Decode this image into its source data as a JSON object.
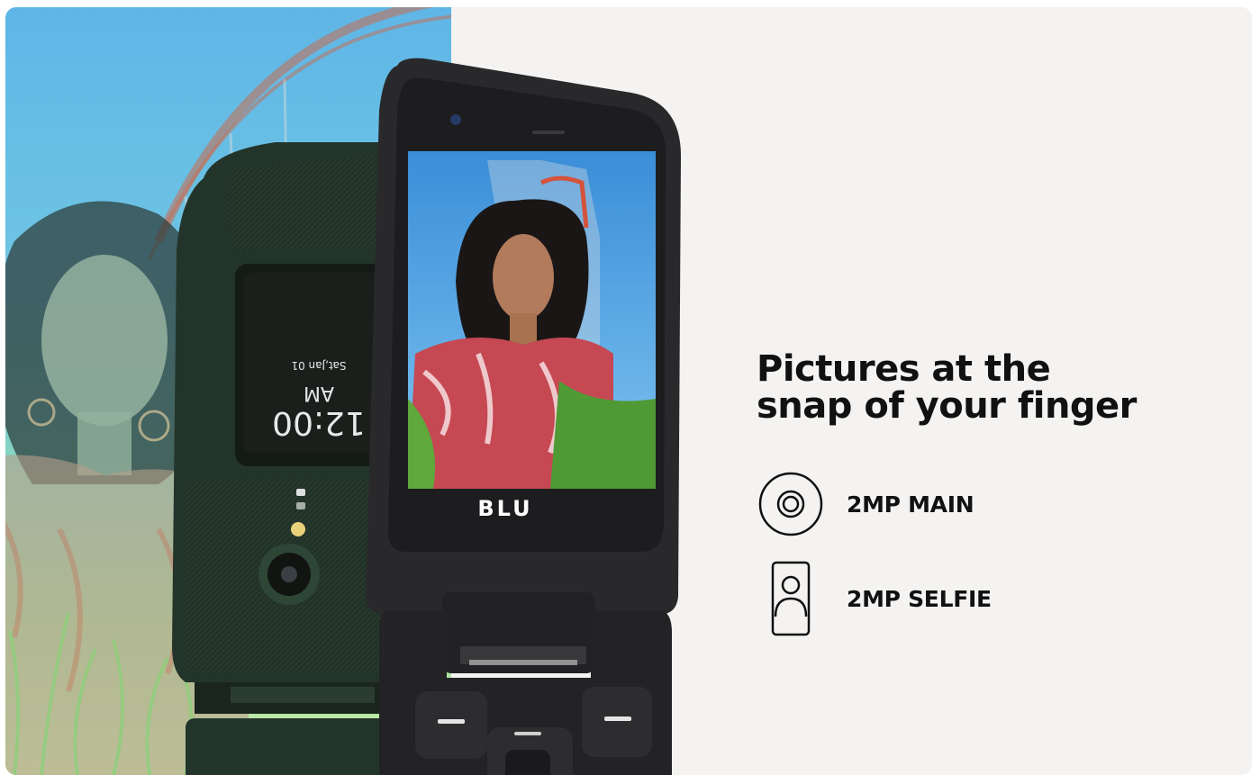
{
  "headline": {
    "line1": "Pictures at the",
    "line2": "snap of your finger"
  },
  "features": [
    {
      "icon": "rear-camera-icon",
      "label": "2MP MAIN"
    },
    {
      "icon": "selfie-camera-icon",
      "label": "2MP SELFIE"
    }
  ],
  "phone": {
    "brand": "BLU",
    "outer_screen": {
      "date": "Sat,Jan 01",
      "time": "12:00",
      "ampm": "AM"
    }
  },
  "colors": {
    "background": "#f4f3f1",
    "text": "#111111",
    "phone_green": "#24352a",
    "phone_black": "#1f2022"
  }
}
